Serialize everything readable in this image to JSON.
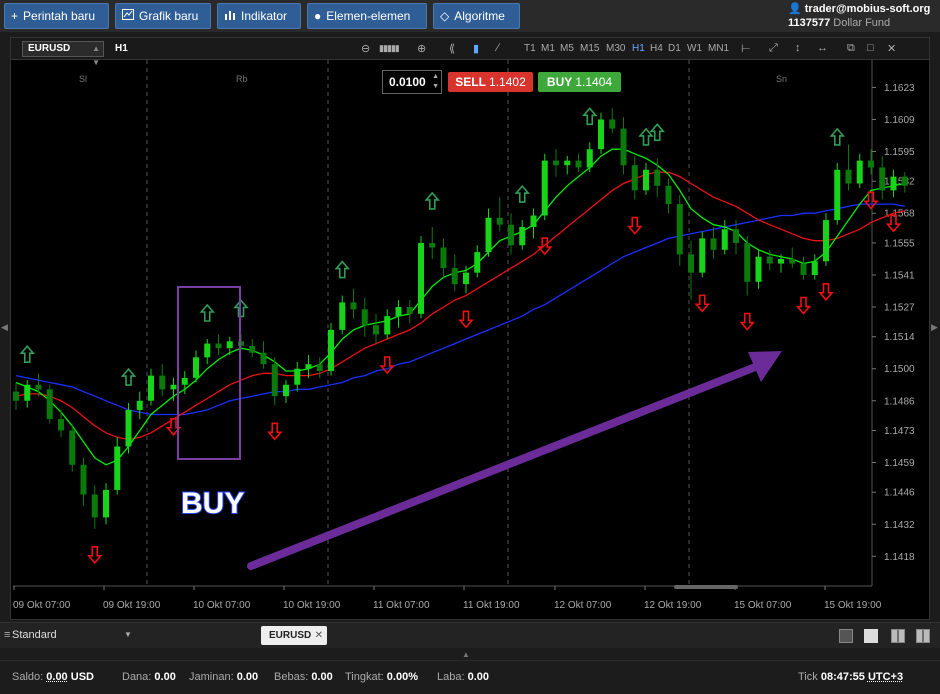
{
  "toolbar": {
    "new_order": "Perintah baru",
    "new_chart": "Grafik baru",
    "indicator": "Indikator",
    "elements": "Elemen-elemen",
    "algorithm": "Algoritme"
  },
  "account": {
    "email": "trader@mobius-soft.org",
    "number": "1137577",
    "fund_name": "Dollar Fund"
  },
  "chart_toolbar": {
    "symbol": "EURUSD",
    "timeframe": "H1",
    "timeframes": [
      "T1",
      "M1",
      "M5",
      "M15",
      "M30",
      "H1",
      "H4",
      "D1",
      "W1",
      "MN1"
    ],
    "active_timeframe": "H1"
  },
  "order_panel": {
    "lots": "0.0100",
    "sell_label": "SELL",
    "sell_price": "1.1402",
    "buy_label": "BUY",
    "buy_price": "1.1404"
  },
  "annotation": {
    "buy_text": "BUY"
  },
  "colors": {
    "bull_candle": "#18d418",
    "bear_candle": "#0a7a0a",
    "ma_fast": "#00ee00",
    "ma_mid": "#ee1111",
    "ma_slow": "#1a2fff",
    "up_arrow": "#2f9e58",
    "down_arrow": "#ee1111",
    "highlight_box": "#7a3fa0",
    "trend_arrow": "#6b2c9a",
    "buy_text": "#2244ff"
  },
  "chart_data": {
    "type": "candlestick",
    "symbol": "EURUSD",
    "timeframe": "H1",
    "ylim": [
      1.1405,
      1.1635
    ],
    "y_ticks": [
      "1.1623",
      "1.1609",
      "1.1595",
      "1.1582",
      "1.1568",
      "1.1555",
      "1.1541",
      "1.1527",
      "1.1514",
      "1.1500",
      "1.1486",
      "1.1473",
      "1.1459",
      "1.1446",
      "1.1432",
      "1.1418"
    ],
    "x_ticks": [
      "09 Okt 07:00",
      "09 Okt 19:00",
      "10 Okt 07:00",
      "10 Okt 19:00",
      "11 Okt 07:00",
      "11 Okt 19:00",
      "12 Okt 07:00",
      "12 Okt 19:00",
      "15 Okt 07:00",
      "15 Okt 19:00"
    ],
    "day_labels": [
      "Sl",
      "Rb",
      "Sn"
    ],
    "candles": [
      [
        1.149,
        1.1494,
        1.1482,
        1.1486
      ],
      [
        1.1486,
        1.1495,
        1.1483,
        1.1493
      ],
      [
        1.1493,
        1.1498,
        1.1488,
        1.1491
      ],
      [
        1.1491,
        1.1493,
        1.1476,
        1.1478
      ],
      [
        1.1478,
        1.1482,
        1.147,
        1.1473
      ],
      [
        1.1473,
        1.1476,
        1.1455,
        1.1458
      ],
      [
        1.1458,
        1.1461,
        1.144,
        1.1445
      ],
      [
        1.1445,
        1.1449,
        1.143,
        1.1435
      ],
      [
        1.1435,
        1.145,
        1.1432,
        1.1447
      ],
      [
        1.1447,
        1.147,
        1.1445,
        1.1466
      ],
      [
        1.1466,
        1.1485,
        1.1463,
        1.1482
      ],
      [
        1.1482,
        1.149,
        1.1478,
        1.1486
      ],
      [
        1.1486,
        1.15,
        1.1484,
        1.1497
      ],
      [
        1.1497,
        1.1502,
        1.1488,
        1.1491
      ],
      [
        1.1491,
        1.1496,
        1.1486,
        1.1493
      ],
      [
        1.1493,
        1.1499,
        1.1489,
        1.1496
      ],
      [
        1.1496,
        1.1508,
        1.1494,
        1.1505
      ],
      [
        1.1505,
        1.1513,
        1.1502,
        1.1511
      ],
      [
        1.1511,
        1.1515,
        1.1506,
        1.1509
      ],
      [
        1.1509,
        1.1514,
        1.1506,
        1.1512
      ],
      [
        1.1512,
        1.1515,
        1.1508,
        1.151
      ],
      [
        1.151,
        1.1513,
        1.1505,
        1.1507
      ],
      [
        1.1507,
        1.1512,
        1.15,
        1.1502
      ],
      [
        1.1502,
        1.1505,
        1.1484,
        1.1488
      ],
      [
        1.1488,
        1.1495,
        1.1485,
        1.1493
      ],
      [
        1.1493,
        1.1503,
        1.149,
        1.15
      ],
      [
        1.15,
        1.1506,
        1.1496,
        1.1502
      ],
      [
        1.1502,
        1.1505,
        1.1496,
        1.1499
      ],
      [
        1.1499,
        1.152,
        1.1497,
        1.1517
      ],
      [
        1.1517,
        1.1532,
        1.1515,
        1.1529
      ],
      [
        1.1529,
        1.1535,
        1.1522,
        1.1526
      ],
      [
        1.1526,
        1.1531,
        1.1514,
        1.1519
      ],
      [
        1.1519,
        1.1524,
        1.1511,
        1.1515
      ],
      [
        1.1515,
        1.1526,
        1.1513,
        1.1523
      ],
      [
        1.1523,
        1.153,
        1.1518,
        1.1527
      ],
      [
        1.1527,
        1.153,
        1.152,
        1.1524
      ],
      [
        1.1524,
        1.1558,
        1.1522,
        1.1555
      ],
      [
        1.1555,
        1.1562,
        1.1548,
        1.1553
      ],
      [
        1.1553,
        1.1557,
        1.154,
        1.1544
      ],
      [
        1.1544,
        1.155,
        1.1534,
        1.1537
      ],
      [
        1.1537,
        1.1545,
        1.1533,
        1.1542
      ],
      [
        1.1542,
        1.1554,
        1.154,
        1.1551
      ],
      [
        1.1551,
        1.157,
        1.1549,
        1.1566
      ],
      [
        1.1566,
        1.1575,
        1.156,
        1.1563
      ],
      [
        1.1563,
        1.1568,
        1.155,
        1.1554
      ],
      [
        1.1554,
        1.1565,
        1.1552,
        1.1562
      ],
      [
        1.1562,
        1.157,
        1.1557,
        1.1567
      ],
      [
        1.1567,
        1.1594,
        1.1565,
        1.1591
      ],
      [
        1.1591,
        1.1596,
        1.1584,
        1.1589
      ],
      [
        1.1589,
        1.1593,
        1.1585,
        1.1591
      ],
      [
        1.1591,
        1.1594,
        1.1586,
        1.1588
      ],
      [
        1.1588,
        1.1599,
        1.1586,
        1.1596
      ],
      [
        1.1596,
        1.1612,
        1.1594,
        1.1609
      ],
      [
        1.1609,
        1.1614,
        1.1603,
        1.1605
      ],
      [
        1.1605,
        1.161,
        1.1585,
        1.1589
      ],
      [
        1.1589,
        1.1593,
        1.1574,
        1.1578
      ],
      [
        1.1578,
        1.159,
        1.1576,
        1.1587
      ],
      [
        1.1587,
        1.1592,
        1.1575,
        1.158
      ],
      [
        1.158,
        1.1583,
        1.1568,
        1.1572
      ],
      [
        1.1572,
        1.1576,
        1.1545,
        1.155
      ],
      [
        1.155,
        1.1556,
        1.153,
        1.1542
      ],
      [
        1.1542,
        1.156,
        1.154,
        1.1557
      ],
      [
        1.1557,
        1.1562,
        1.1548,
        1.1552
      ],
      [
        1.1552,
        1.1565,
        1.155,
        1.1561
      ],
      [
        1.1561,
        1.1565,
        1.155,
        1.1555
      ],
      [
        1.1555,
        1.1558,
        1.1532,
        1.1538
      ],
      [
        1.1538,
        1.1552,
        1.1535,
        1.1549
      ],
      [
        1.1549,
        1.1552,
        1.1543,
        1.1546
      ],
      [
        1.1546,
        1.155,
        1.1542,
        1.1548
      ],
      [
        1.1548,
        1.1553,
        1.1544,
        1.1546
      ],
      [
        1.1546,
        1.1549,
        1.1539,
        1.1541
      ],
      [
        1.1541,
        1.155,
        1.1539,
        1.1547
      ],
      [
        1.1547,
        1.1568,
        1.1545,
        1.1565
      ],
      [
        1.1565,
        1.159,
        1.1563,
        1.1587
      ],
      [
        1.1587,
        1.1598,
        1.1578,
        1.1581
      ],
      [
        1.1581,
        1.1594,
        1.1579,
        1.1591
      ],
      [
        1.1591,
        1.1596,
        1.1585,
        1.1588
      ],
      [
        1.1588,
        1.1593,
        1.1574,
        1.1578
      ],
      [
        1.1578,
        1.1587,
        1.1575,
        1.1584
      ],
      [
        1.1584,
        1.1586,
        1.1577,
        1.158
      ]
    ],
    "ma_fast": [
      1.1494,
      1.1492,
      1.149,
      1.1486,
      1.1481,
      1.1475,
      1.1468,
      1.1461,
      1.1458,
      1.146,
      1.1466,
      1.1473,
      1.148,
      1.1484,
      1.1488,
      1.1491,
      1.1495,
      1.15,
      1.1504,
      1.1507,
      1.1509,
      1.1508,
      1.1506,
      1.1503,
      1.1499,
      1.1499,
      1.15,
      1.1502,
      1.1507,
      1.1513,
      1.1517,
      1.1519,
      1.152,
      1.1521,
      1.1523,
      1.1524,
      1.153,
      1.1536,
      1.154,
      1.1542,
      1.1543,
      1.1546,
      1.1551,
      1.1556,
      1.1558,
      1.156,
      1.1563,
      1.1569,
      1.1575,
      1.158,
      1.1584,
      1.1588,
      1.1593,
      1.1596,
      1.1596,
      1.1594,
      1.1592,
      1.1589,
      1.1585,
      1.1578,
      1.157,
      1.1566,
      1.1563,
      1.1562,
      1.156,
      1.1555,
      1.1552,
      1.155,
      1.1549,
      1.1548,
      1.1546,
      1.1547,
      1.1551,
      1.1558,
      1.1565,
      1.1572,
      1.1578,
      1.1579,
      1.158,
      1.1581
    ],
    "ma_mid": [
      1.1488,
      1.1489,
      1.1489,
      1.1488,
      1.1486,
      1.1483,
      1.1479,
      1.1475,
      1.1472,
      1.147,
      1.1469,
      1.147,
      1.1472,
      1.1475,
      1.1478,
      1.1481,
      1.1484,
      1.1487,
      1.149,
      1.1493,
      1.1495,
      1.1497,
      1.1498,
      1.1498,
      1.1497,
      1.1497,
      1.1497,
      1.1498,
      1.15,
      1.1503,
      1.1506,
      1.1509,
      1.1511,
      1.1513,
      1.1515,
      1.1517,
      1.152,
      1.1524,
      1.1527,
      1.153,
      1.1532,
      1.1535,
      1.1538,
      1.1541,
      1.1544,
      1.1547,
      1.155,
      1.1554,
      1.1558,
      1.1562,
      1.1566,
      1.157,
      1.1574,
      1.1578,
      1.1581,
      1.1583,
      1.1585,
      1.1586,
      1.1586,
      1.1584,
      1.1581,
      1.1578,
      1.1575,
      1.1573,
      1.1571,
      1.1568,
      1.1565,
      1.1563,
      1.1561,
      1.1559,
      1.1557,
      1.1556,
      1.1556,
      1.1557,
      1.1559,
      1.1561,
      1.1564,
      1.1566,
      1.1568,
      1.1569
    ],
    "ma_slow": [
      1.1497,
      1.1496,
      1.1495,
      1.1494,
      1.1493,
      1.1492,
      1.149,
      1.1488,
      1.1486,
      1.1484,
      1.1482,
      1.1481,
      1.148,
      1.148,
      1.148,
      1.148,
      1.1481,
      1.1482,
      1.1484,
      1.1486,
      1.1487,
      1.1488,
      1.1489,
      1.149,
      1.149,
      1.1491,
      1.1491,
      1.1492,
      1.1493,
      1.1494,
      1.1496,
      1.1497,
      1.1499,
      1.15,
      1.1502,
      1.1503,
      1.1505,
      1.1507,
      1.1509,
      1.1511,
      1.1513,
      1.1515,
      1.1517,
      1.1519,
      1.1521,
      1.1523,
      1.1526,
      1.1528,
      1.1531,
      1.1534,
      1.1537,
      1.154,
      1.1543,
      1.1546,
      1.1549,
      1.1551,
      1.1553,
      1.1555,
      1.1557,
      1.1558,
      1.1559,
      1.156,
      1.1561,
      1.1562,
      1.1563,
      1.1564,
      1.1565,
      1.1566,
      1.1567,
      1.1567,
      1.1568,
      1.1568,
      1.1569,
      1.157,
      1.1571,
      1.1572,
      1.1572,
      1.1572,
      1.1572,
      1.1571
    ],
    "up_signals": [
      1,
      10,
      17,
      20,
      29,
      37,
      45,
      51,
      56,
      57,
      73
    ],
    "down_signals": [
      7,
      14,
      23,
      33,
      40,
      47,
      55,
      61,
      65,
      70,
      72,
      76,
      78
    ]
  },
  "bottom_bar": {
    "template": "Standard",
    "symbol_tab": "EURUSD",
    "status": {
      "saldo_label": "Saldo:",
      "saldo_value": "0.00",
      "saldo_ccy": "USD",
      "dana_label": "Dana:",
      "dana_value": "0.00",
      "jaminan_label": "Jaminan:",
      "jaminan_value": "0.00",
      "bebas_label": "Bebas:",
      "bebas_value": "0.00",
      "tingkat_label": "Tingkat:",
      "tingkat_value": "0.00%",
      "laba_label": "Laba:",
      "laba_value": "0.00",
      "tick_label": "Tick",
      "tick_value": "08:47:55",
      "tz": "UTC+3"
    }
  }
}
